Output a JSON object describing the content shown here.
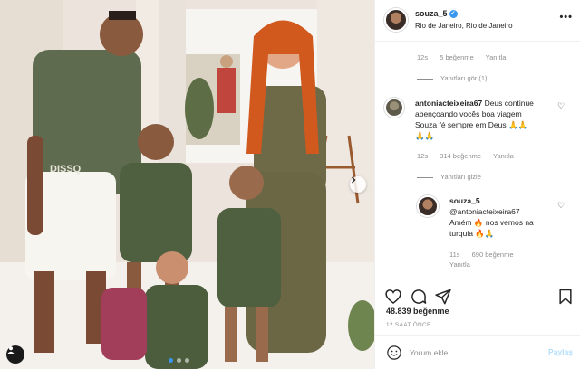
{
  "header": {
    "username": "souza_5",
    "location": "Rio de Janeiro, Rio de Janeiro",
    "more_icon": "more-horizontal-icon",
    "verified_icon": "verified-badge-icon"
  },
  "comments": {
    "first_meta": {
      "time": "12s",
      "likes": "5 beğenme",
      "reply": "Yanıtla"
    },
    "view_replies": "Yanıtları gör (1)",
    "comment_1": {
      "username": "antoniacteixeira67",
      "text": "Deus continue abençoando vocês boa viagem Souza fé sempre em Deus 🙏🙏 🏈",
      "line1": "Deus continue",
      "line2": "abençoando vocês boa viagem",
      "line3": "Souza fé sempre em Deus 🙏🙏",
      "line4": "🙏🙏",
      "time": "12s",
      "likes": "314 beğenme",
      "reply": "Yanıtla"
    },
    "hide_replies": "Yanıtları gizle",
    "reply_1": {
      "username": "souza_5",
      "line1": "@antoniacteixeira67",
      "line2": "Amém 🔥 nos vemos na",
      "line3": "turquia 🔥🙏",
      "time": "11s",
      "likes": "690 beğenme",
      "reply": "Yanıtla"
    }
  },
  "actions": {
    "like_icon": "heart-icon",
    "comment_icon": "comment-icon",
    "share_icon": "send-icon",
    "save_icon": "bookmark-icon"
  },
  "likes_count": "48.839 beğenme",
  "posted_time": "12 SAAT ÖNCE",
  "add_comment": {
    "placeholder": "Yorum ekle...",
    "post_label": "Paylaş",
    "emoji_icon": "smile-icon"
  },
  "colors": {
    "link_blue": "#3897f0",
    "post_disabled": "#b2dffc",
    "meta_gray": "#8e8e8e",
    "text_dark": "#262626"
  }
}
